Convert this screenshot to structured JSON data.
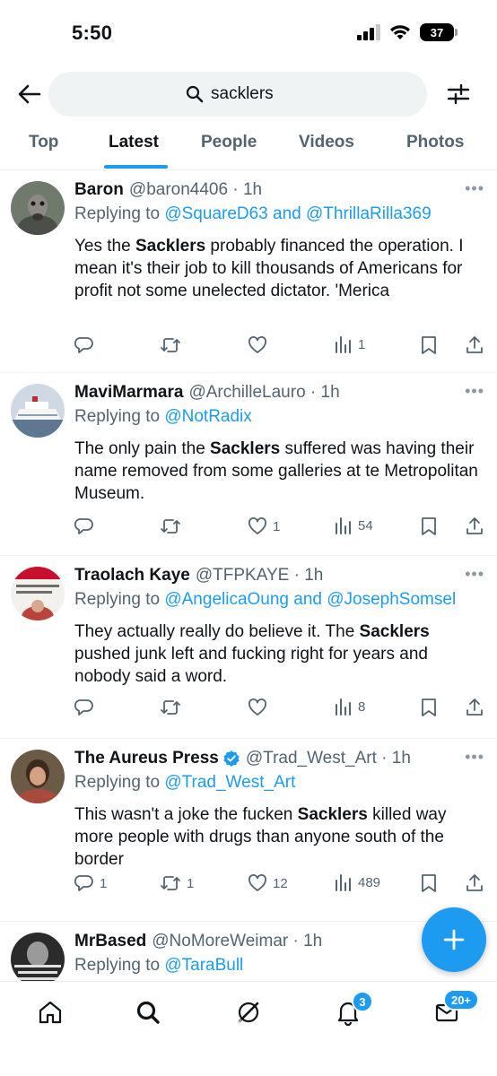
{
  "status_bar": {
    "time": "5:50",
    "battery": "37"
  },
  "search": {
    "query": "sacklers"
  },
  "tabs": [
    {
      "label": "Top"
    },
    {
      "label": "Latest",
      "active": true
    },
    {
      "label": "People"
    },
    {
      "label": "Videos"
    },
    {
      "label": "Photos"
    }
  ],
  "tweets": [
    {
      "name": "Baron",
      "handle": "@baron4406",
      "time": "1h",
      "replying_prefix": "Replying to",
      "replying_to": "@SquareD63 and @ThrillaRilla369",
      "body_pre": "Yes the ",
      "body_bold": "Sacklers",
      "body_post": " probably financed the operation. I mean it's their job to kill thousands of Americans for profit not some unelected dictator. 'Merica",
      "replies": "",
      "retweets": "",
      "likes": "",
      "views": "1"
    },
    {
      "name": "MaviMarmara",
      "handle": "@ArchilleLauro",
      "time": "1h",
      "replying_prefix": "Replying to",
      "replying_to": "@NotRadix",
      "body_pre": "The only pain the ",
      "body_bold": "Sacklers",
      "body_post": " suffered was having their name removed from some galleries at te Metropolitan Museum.",
      "replies": "",
      "retweets": "",
      "likes": "1",
      "views": "54"
    },
    {
      "name": "Traolach Kaye",
      "handle": "@TFPKAYE",
      "time": "1h",
      "replying_prefix": "Replying to",
      "replying_to": "@AngelicaOung and @JosephSomsel",
      "body_pre": "They actually really do believe it. The ",
      "body_bold": "Sacklers",
      "body_post": " pushed junk left and fucking right for years and nobody said a word.",
      "replies": "",
      "retweets": "",
      "likes": "",
      "views": "8"
    },
    {
      "name": "The Aureus Press",
      "verified": true,
      "handle": "@Trad_West_Art",
      "time": "1h",
      "replying_prefix": "Replying to",
      "replying_to": "@Trad_West_Art",
      "body_pre": "This wasn't a joke the fucken ",
      "body_bold": "Sacklers",
      "body_post": " killed way more people with drugs than anyone south of the border",
      "replies": "1",
      "retweets": "1",
      "likes": "12",
      "views": "489"
    },
    {
      "name": "MrBased",
      "handle": "@NoMoreWeimar",
      "time": "1h",
      "replying_prefix": "Replying to",
      "replying_to": "@TaraBull"
    }
  ],
  "bottom_nav": {
    "notifications_badge": "3",
    "messages_badge": "20+"
  },
  "colors": {
    "accent": "#1d9bf0",
    "text_primary": "#0f1419",
    "text_secondary": "#536471",
    "search_bg": "#eff3f4"
  }
}
